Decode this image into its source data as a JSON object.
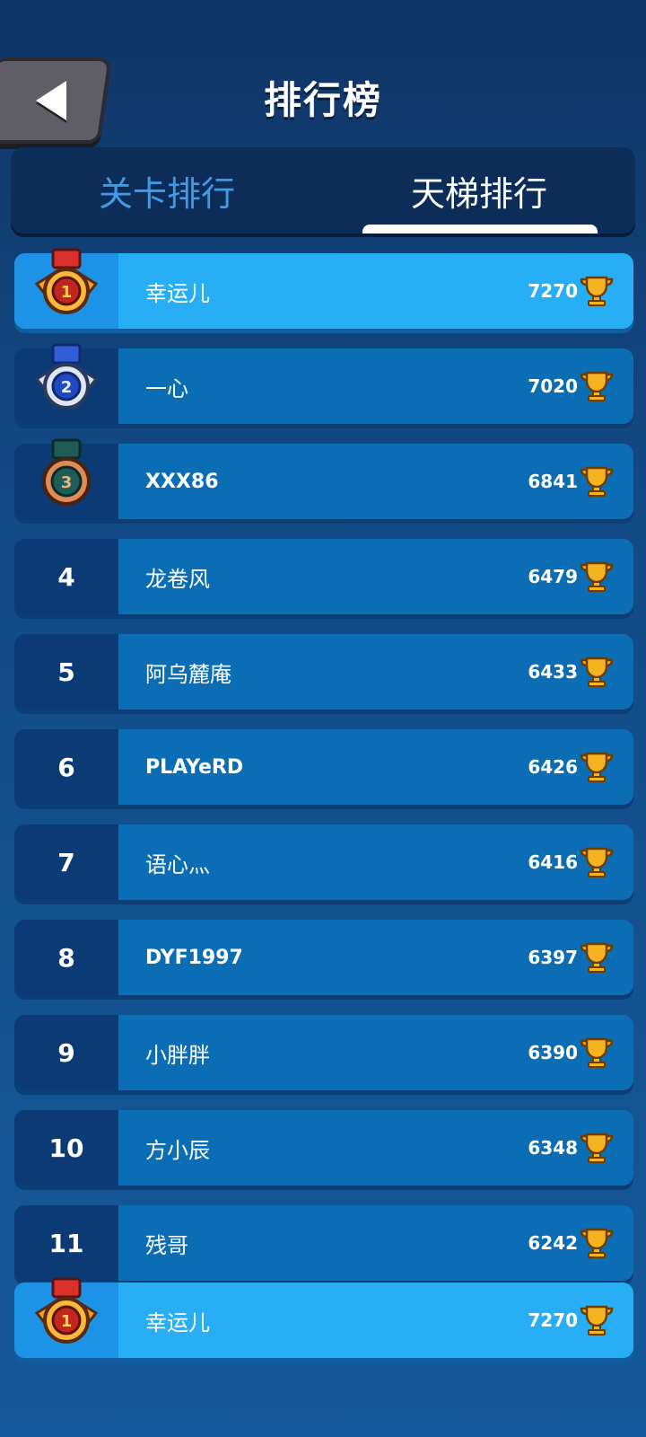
{
  "header": {
    "title": "排行榜"
  },
  "tabs": [
    {
      "label": "关卡排行",
      "active": false
    },
    {
      "label": "天梯排行",
      "active": true
    }
  ],
  "rows": [
    {
      "rank": "1",
      "name": "幸运儿",
      "score": "7270",
      "medal": "gold"
    },
    {
      "rank": "2",
      "name": "一心",
      "score": "7020",
      "medal": "silver"
    },
    {
      "rank": "3",
      "name": "XXX86",
      "score": "6841",
      "medal": "bronze"
    },
    {
      "rank": "4",
      "name": "龙卷风",
      "score": "6479"
    },
    {
      "rank": "5",
      "name": "阿乌麓庵",
      "score": "6433"
    },
    {
      "rank": "6",
      "name": "PLAYeRD",
      "score": "6426"
    },
    {
      "rank": "7",
      "name": "语心灬",
      "score": "6416"
    },
    {
      "rank": "8",
      "name": "DYF1997",
      "score": "6397"
    },
    {
      "rank": "9",
      "name": "小胖胖",
      "score": "6390"
    },
    {
      "rank": "10",
      "name": "方小辰",
      "score": "6348"
    },
    {
      "rank": "11",
      "name": "残哥",
      "score": "6242"
    }
  ],
  "my_row": {
    "rank": "1",
    "name": "幸运儿",
    "score": "7270",
    "medal": "gold"
  },
  "icons": {
    "back": "back-arrow-icon",
    "trophy": "trophy-icon",
    "medal": "medal-icon"
  },
  "colors": {
    "highlight": "#27aef4",
    "row": "#0b6db3",
    "rank_bg": "#0c3a75",
    "inactive_tab": "#3f9be8"
  }
}
